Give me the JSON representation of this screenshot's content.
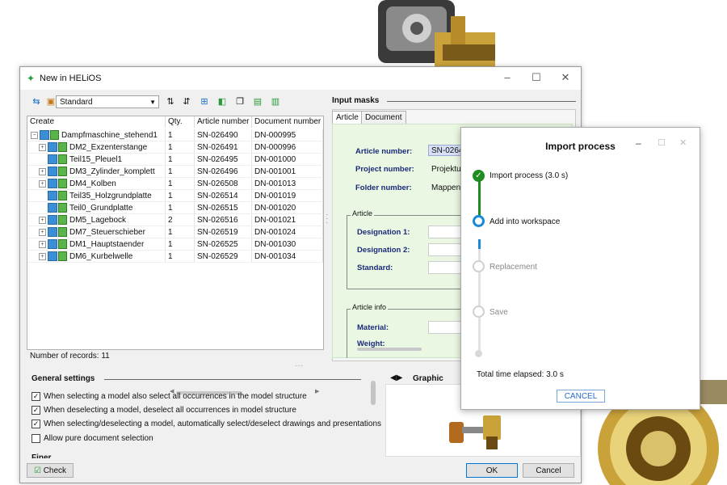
{
  "dialog": {
    "title": "New in HELiOS",
    "icon": "helios-icon"
  },
  "toolbar": {
    "view_select": "Standard"
  },
  "tree": {
    "columns": [
      "Create",
      "Qty.",
      "Article number",
      "Document number"
    ],
    "rows": [
      {
        "name": "Dampfmaschine_stehend1",
        "qty": "1",
        "article": "SN-026490",
        "document": "DN-000995",
        "level": 0,
        "expander": "−"
      },
      {
        "name": "DM2_Exzenterstange",
        "qty": "1",
        "article": "SN-026491",
        "document": "DN-000996",
        "level": 1,
        "expander": "+"
      },
      {
        "name": "Teil15_Pleuel1",
        "qty": "1",
        "article": "SN-026495",
        "document": "DN-001000",
        "level": 1,
        "expander": ""
      },
      {
        "name": "DM3_Zylinder_komplett",
        "qty": "1",
        "article": "SN-026496",
        "document": "DN-001001",
        "level": 1,
        "expander": "+"
      },
      {
        "name": "DM4_Kolben",
        "qty": "1",
        "article": "SN-026508",
        "document": "DN-001013",
        "level": 1,
        "expander": "+"
      },
      {
        "name": "Teil35_Holzgrundplatte",
        "qty": "1",
        "article": "SN-026514",
        "document": "DN-001019",
        "level": 1,
        "expander": ""
      },
      {
        "name": "Teil0_Grundplatte",
        "qty": "1",
        "article": "SN-026515",
        "document": "DN-001020",
        "level": 1,
        "expander": ""
      },
      {
        "name": "DM5_Lagebock",
        "qty": "2",
        "article": "SN-026516",
        "document": "DN-001021",
        "level": 1,
        "expander": "+"
      },
      {
        "name": "DM7_Steuerschieber",
        "qty": "1",
        "article": "SN-026519",
        "document": "DN-001024",
        "level": 1,
        "expander": "+"
      },
      {
        "name": "DM1_Hauptstaender",
        "qty": "1",
        "article": "SN-026525",
        "document": "DN-001030",
        "level": 1,
        "expander": "+"
      },
      {
        "name": "DM6_Kurbelwelle",
        "qty": "1",
        "article": "SN-026529",
        "document": "DN-001034",
        "level": 1,
        "expander": "+"
      }
    ],
    "records": "Number of records: 11"
  },
  "input_masks": {
    "title": "Input masks",
    "tabs": [
      "Article",
      "Document"
    ],
    "fields": {
      "article_number_label": "Article number:",
      "article_number_value": "SN-0264",
      "project_number_label": "Project number:",
      "project_number_value": "Projektu",
      "folder_number_label": "Folder number:",
      "folder_number_value": "Mappenu"
    },
    "article_group": "Article",
    "designation1": "Designation 1:",
    "designation2": "Designation 2:",
    "standard": "Standard:",
    "article_info_group": "Article info",
    "material": "Material:",
    "weight": "Weight:"
  },
  "general_settings": {
    "title": "General settings",
    "options": [
      {
        "label": "When selecting a model also select all occurrences in the model structure",
        "checked": true
      },
      {
        "label": "When deselecting a model, deselect all occurrences in model structure",
        "checked": true
      },
      {
        "label": "When selecting/deselecting a model, automatically select/deselect drawings and presentations",
        "checked": true
      },
      {
        "label": "Allow pure document selection",
        "checked": false
      }
    ],
    "cut_label": "Finer..."
  },
  "graphic": {
    "title": "Graphic"
  },
  "buttons": {
    "check": "Check",
    "ok": "OK",
    "cancel": "Cancel"
  },
  "import_process": {
    "title": "Import process",
    "steps": [
      {
        "label": "Import process (3.0 s)",
        "state": "done"
      },
      {
        "label": "Add into workspace",
        "state": "active"
      },
      {
        "label": "Replacement",
        "state": "pending"
      },
      {
        "label": "Save",
        "state": "pending"
      }
    ],
    "elapsed": "Total time elapsed: 3.0 s",
    "cancel": "CANCEL"
  },
  "colors": {
    "accent": "#0078d7",
    "done_green": "#1e8c1e",
    "active_blue": "#1a8ad8",
    "mask_green": "#eaf7e2",
    "label_navy": "#1a2a7a"
  }
}
